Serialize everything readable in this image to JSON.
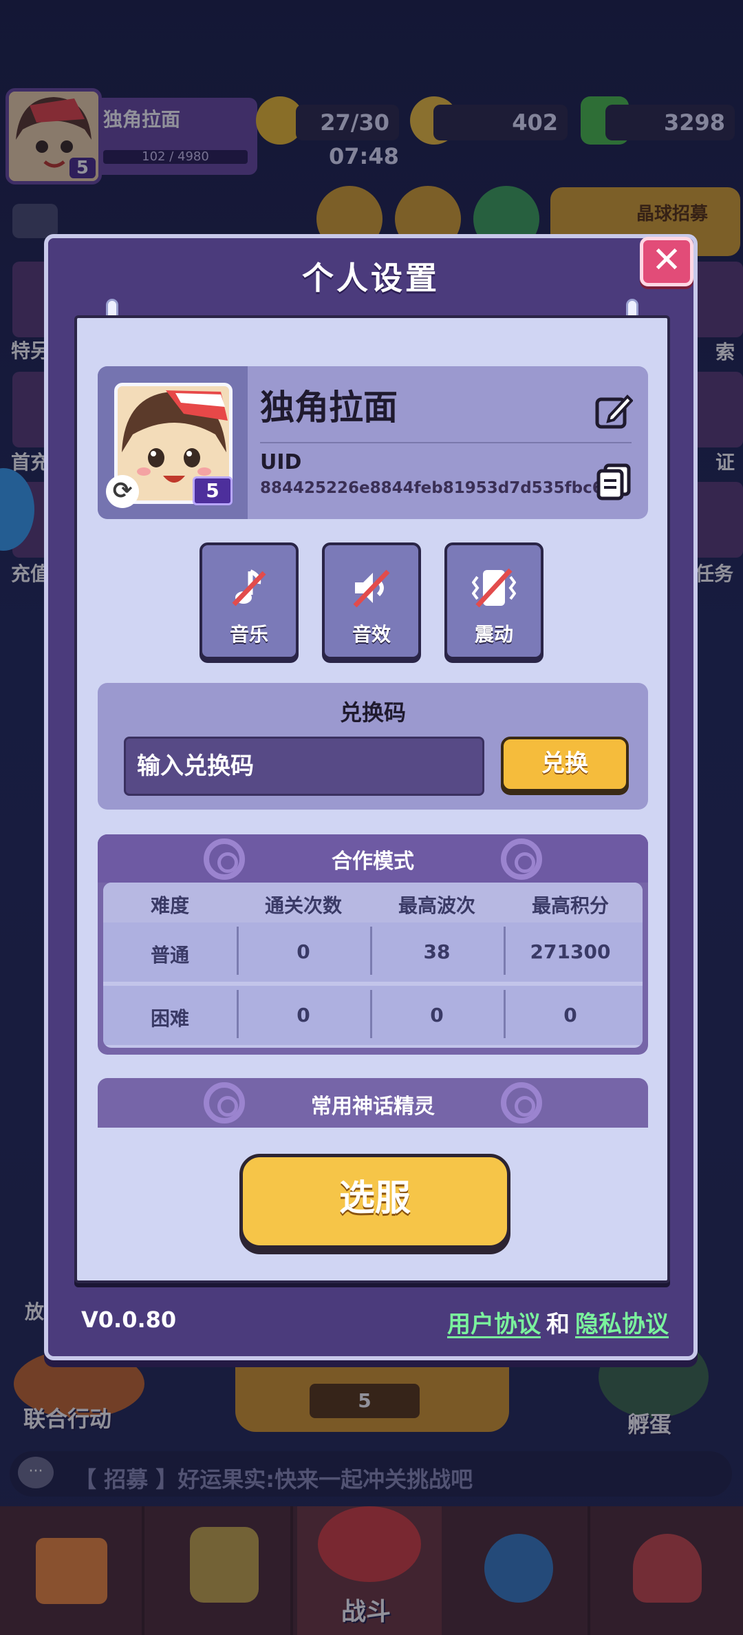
{
  "hud": {
    "player_name": "独角拉面",
    "player_level": "5",
    "exp": "102 / 4980",
    "energy": "27/30",
    "energy_timer": "07:48",
    "coins": "402",
    "gems": "3298",
    "recruit_label": "晶球招募"
  },
  "side": {
    "left_labels": [
      "特另",
      "首充",
      "充值"
    ],
    "right_labels": [
      "索",
      "证",
      "任务"
    ]
  },
  "lower": {
    "left_action": "联合行动",
    "left_partial": "放",
    "challenge_count": "5",
    "right_action": "孵蛋"
  },
  "chat": {
    "message": "【 招募 】好运果实:快来一起冲关挑战吧"
  },
  "bottom_nav": {
    "battle_label": "战斗"
  },
  "modal": {
    "title": "个人设置",
    "close_symbol": "✕",
    "profile": {
      "name": "独角拉面",
      "level": "5",
      "uid_label": "UID",
      "uid": "884425226e8844feb81953d7d535fbc6"
    },
    "toggles": [
      {
        "label": "音乐",
        "icon": "music-note-muted-icon"
      },
      {
        "label": "音效",
        "icon": "speaker-muted-icon"
      },
      {
        "label": "震动",
        "icon": "vibration-off-icon"
      }
    ],
    "redeem": {
      "title": "兑换码",
      "placeholder": "输入兑换码",
      "button": "兑换"
    },
    "coop": {
      "title": "合作模式",
      "headers": [
        "难度",
        "通关次数",
        "最高波次",
        "最高积分"
      ],
      "rows": [
        [
          "普通",
          "0",
          "38",
          "271300"
        ],
        [
          "困难",
          "0",
          "0",
          "0"
        ]
      ]
    },
    "mythic": {
      "title": "常用神话精灵"
    },
    "server_button": "选服",
    "version": "V0.0.80",
    "user_agreement": "用户协议",
    "and": "和",
    "privacy_agreement": "隐私协议"
  },
  "colors": {
    "modal_bg": "#4b3b7c",
    "paper_bg": "#d0d5f3",
    "accent_yellow": "#f6c548",
    "close_red": "#e24c78",
    "link_green": "#7af29d"
  }
}
